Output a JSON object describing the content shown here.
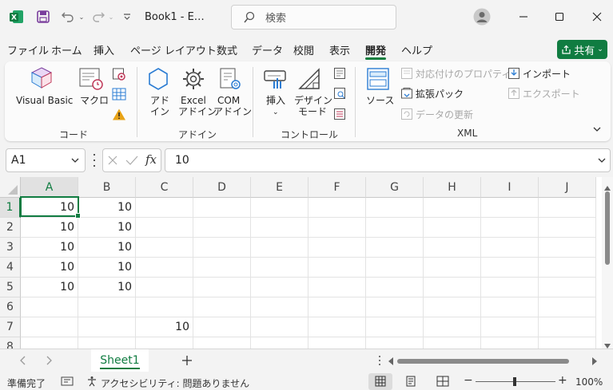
{
  "title_bar": {
    "doc_title": "Book1  -  E…",
    "search_placeholder": "検索",
    "app_letter": "X"
  },
  "menu": {
    "items": [
      "ファイル",
      "ホーム",
      "挿入",
      "ページ レイアウト",
      "数式",
      "データ",
      "校閲",
      "表示",
      "開発",
      "ヘルプ"
    ],
    "active": "開発",
    "share_label": "共有"
  },
  "ribbon": {
    "code": {
      "visual_basic": "Visual Basic",
      "macro": "マクロ",
      "group_label": "コード"
    },
    "addins": {
      "addin_l1": "アド",
      "addin_l2": "イン",
      "excel_l1": "Excel",
      "excel_l2": "アドイン",
      "com_l1": "COM",
      "com_l2": "アドイン",
      "group_label": "アドイン"
    },
    "controls": {
      "insert": "挿入",
      "design_l1": "デザイン",
      "design_l2": "モード",
      "group_label": "コントロール"
    },
    "xml": {
      "source": "ソース",
      "map_props": "対応付けのプロパティ",
      "expansion": "拡張パック",
      "refresh": "データの更新",
      "import": "インポート",
      "export": "エクスポート",
      "group_label": "XML"
    }
  },
  "formula_bar": {
    "name_box": "A1",
    "fx": "fx",
    "formula": "10"
  },
  "sheet": {
    "columns": [
      "A",
      "B",
      "C",
      "D",
      "E",
      "F",
      "G",
      "H",
      "I",
      "J"
    ],
    "rows": [
      "1",
      "2",
      "3",
      "4",
      "5",
      "6",
      "7",
      "8"
    ],
    "cells": [
      {
        "ref": "A1",
        "col": 0,
        "row": 0,
        "value": "10"
      },
      {
        "ref": "B1",
        "col": 1,
        "row": 0,
        "value": "10"
      },
      {
        "ref": "A2",
        "col": 0,
        "row": 1,
        "value": "10"
      },
      {
        "ref": "B2",
        "col": 1,
        "row": 1,
        "value": "10"
      },
      {
        "ref": "A3",
        "col": 0,
        "row": 2,
        "value": "10"
      },
      {
        "ref": "B3",
        "col": 1,
        "row": 2,
        "value": "10"
      },
      {
        "ref": "A4",
        "col": 0,
        "row": 3,
        "value": "10"
      },
      {
        "ref": "B4",
        "col": 1,
        "row": 3,
        "value": "10"
      },
      {
        "ref": "A5",
        "col": 0,
        "row": 4,
        "value": "10"
      },
      {
        "ref": "B5",
        "col": 1,
        "row": 4,
        "value": "10"
      },
      {
        "ref": "C7",
        "col": 2,
        "row": 6,
        "value": "10"
      }
    ]
  },
  "tabs": {
    "sheet_name": "Sheet1"
  },
  "status": {
    "ready": "準備完了",
    "accessibility": "アクセシビリティ: 問題ありません",
    "zoom": "100%",
    "zoom_minus": "−",
    "zoom_plus": "+"
  },
  "colors": {
    "accent": "#107c41",
    "warning": "#e8a317"
  }
}
